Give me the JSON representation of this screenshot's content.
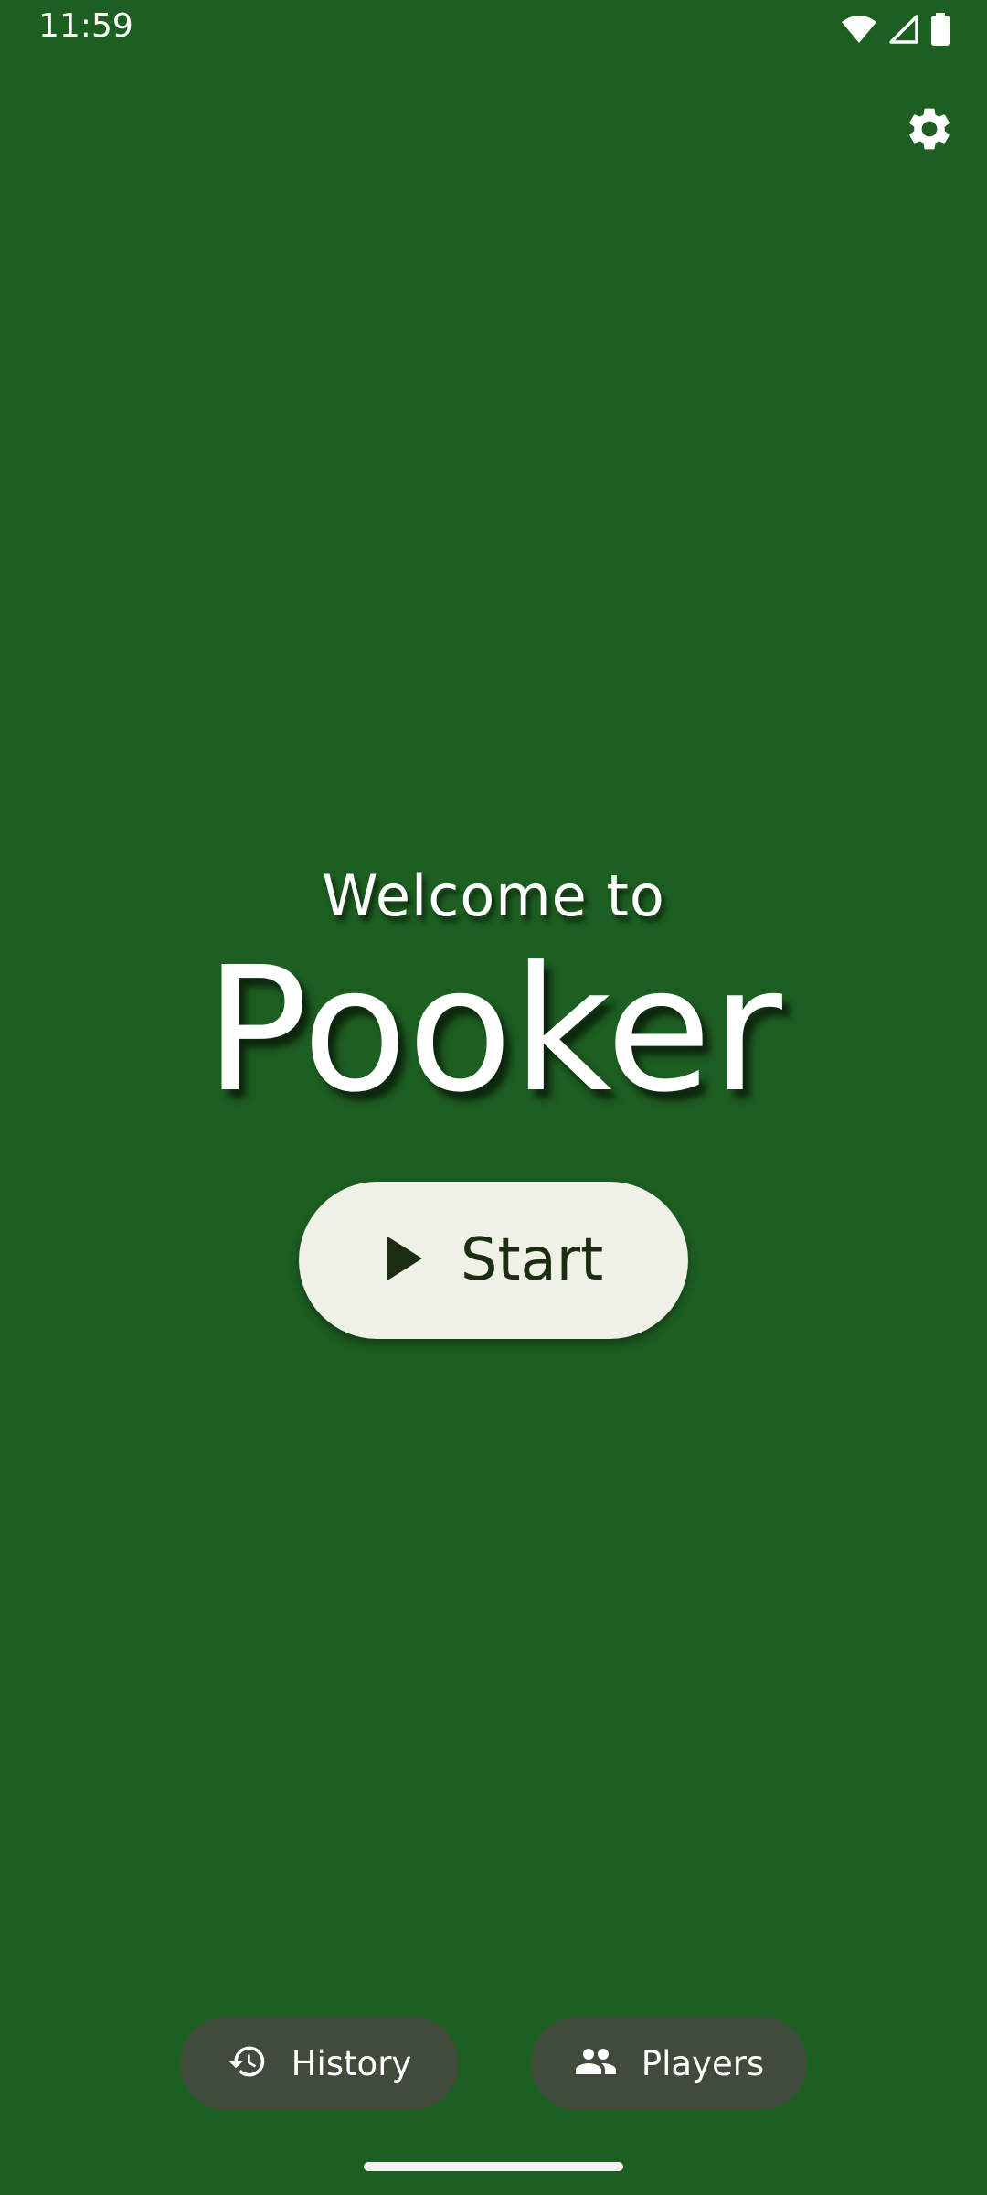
{
  "status_bar": {
    "time": "11:59",
    "icons": [
      "wifi-icon",
      "signal-icon",
      "battery-icon"
    ]
  },
  "header": {
    "settings_icon": "gear-icon"
  },
  "hero": {
    "welcome_text": "Welcome to",
    "app_title": "Pooker"
  },
  "start_button": {
    "label": "Start",
    "icon": "play-icon"
  },
  "bottom_actions": {
    "history": {
      "label": "History",
      "icon": "history-icon"
    },
    "players": {
      "label": "Players",
      "icon": "people-icon"
    }
  },
  "colors": {
    "background": "#1d5e21",
    "start_button_bg": "#eff1e6",
    "start_button_text": "#1c2e12",
    "bottom_button_bg": "#414b3b"
  }
}
